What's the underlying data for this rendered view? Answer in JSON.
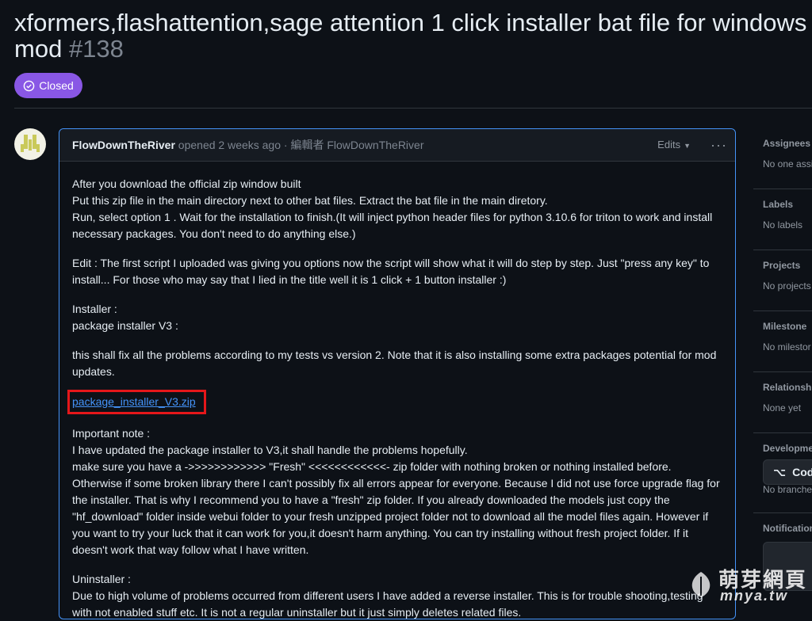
{
  "issue": {
    "title_line1": "xformers,flashattention,sage attention 1 click installer bat file for windows",
    "title_line2": "mod",
    "number": "#138",
    "state": "Closed"
  },
  "comment": {
    "author": "FlowDownTheRiver",
    "meta": " opened 2 weeks ago · 編輯者 ",
    "editor": "FlowDownTheRiver",
    "edits_label": "Edits",
    "more_label": "···",
    "paragraphs": [
      [
        "After you download the official zip window built",
        "Put this zip file in the main directory next to other bat files. Extract the bat file in the main diretory.",
        "Run, select option 1 . Wait for the installation to finish.(It will inject python header files for python 3.10.6 for triton to work and install necessary packages. You don't need to do anything else.)"
      ],
      [
        "Edit : The first script I uploaded was giving you options now the script will show what it will do step by step. Just \"press any key\" to install... For those who may say that I lied in the title well it is 1 click + 1 button installer :)"
      ],
      [
        "Installer :",
        "package installer V3 :"
      ],
      [
        "this shall fix all the problems according to my tests vs version 2. Note that it is also installing some extra packages potential for mod updates."
      ]
    ],
    "attachment_link": "package_installer_V3.zip",
    "paragraphs_after": [
      [
        "Important note :",
        "I have updated the package installer to V3,it shall handle the problems hopefully.",
        "make sure you have a ->>>>>>>>>>>> \"Fresh\" <<<<<<<<<<<<- zip folder with nothing broken or nothing installed before. Otherwise if some broken library there I can't possibly fix all errors appear for everyone. Because I did not use force upgrade flag for the installer. That is why I recommend you to have a \"fresh\" zip folder. If you already downloaded the models just copy the \"hf_download\" folder inside webui folder to your fresh unzipped project folder not to download all the model files again. However if you want to try your luck that it can work for you,it doesn't harm anything. You can try installing without fresh project folder. If it doesn't work that way follow what I have written."
      ],
      [
        "Uninstaller :",
        "Due to high volume of problems occurred from different users I have added a reverse installer. This is for trouble shooting,testing with not enabled stuff etc. It is not a regular uninstaller but it just simply deletes related files."
      ]
    ]
  },
  "sidebar": [
    {
      "heading": "Assignees",
      "value": "No one assi"
    },
    {
      "heading": "Labels",
      "value": "No labels"
    },
    {
      "heading": "Projects",
      "value": "No projects"
    },
    {
      "heading": "Milestone",
      "value": "No milestor"
    },
    {
      "heading": "Relationship",
      "value": "None yet"
    },
    {
      "heading": "Developme",
      "value": "No branche"
    },
    {
      "heading": "Notification",
      "value": ""
    }
  ],
  "code_button": "Cod",
  "watermark": {
    "cn": "萌芽網頁",
    "en": "mnya.tw"
  },
  "colors": {
    "closed_badge": "#8957e5",
    "link": "#4493f8",
    "highlight_box": "#e5171a",
    "background": "#0d1117"
  }
}
